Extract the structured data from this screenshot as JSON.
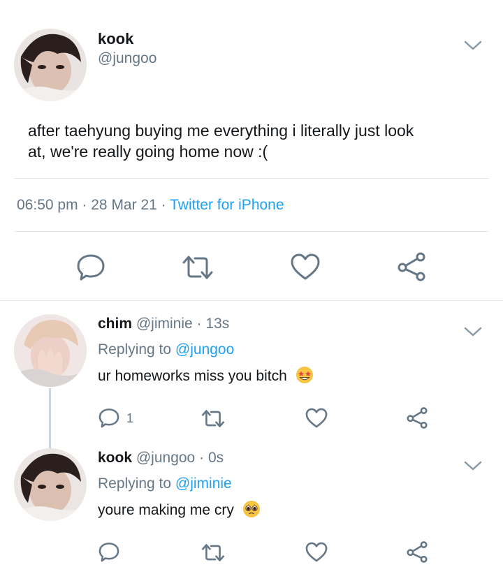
{
  "main_tweet": {
    "display_name": "kook",
    "handle": "@jungoo",
    "text_line1": "after taehyung buying me everything i literally just look",
    "text_line2": "at, we're really going home now :(",
    "time": "06:50 pm",
    "date": "28 Mar 21",
    "source": "Twitter for iPhone",
    "separator": "·"
  },
  "replies": [
    {
      "display_name": "chim",
      "handle": "@jiminie",
      "age": "13s",
      "replying_prefix": "Replying to",
      "replying_to": "@jungoo",
      "text": "ur homeworks miss you bitch",
      "emoji": "star-struck",
      "reply_count": "1"
    },
    {
      "display_name": "kook",
      "handle": "@jungoo",
      "age": "0s",
      "replying_prefix": "Replying to",
      "replying_to": "@jiminie",
      "text": "youre making me cry",
      "emoji": "pleading-face"
    }
  ],
  "colors": {
    "accent": "#1da1f2",
    "secondary_text": "#657786",
    "icon": "#657786",
    "divider": "#e1e8ed"
  }
}
